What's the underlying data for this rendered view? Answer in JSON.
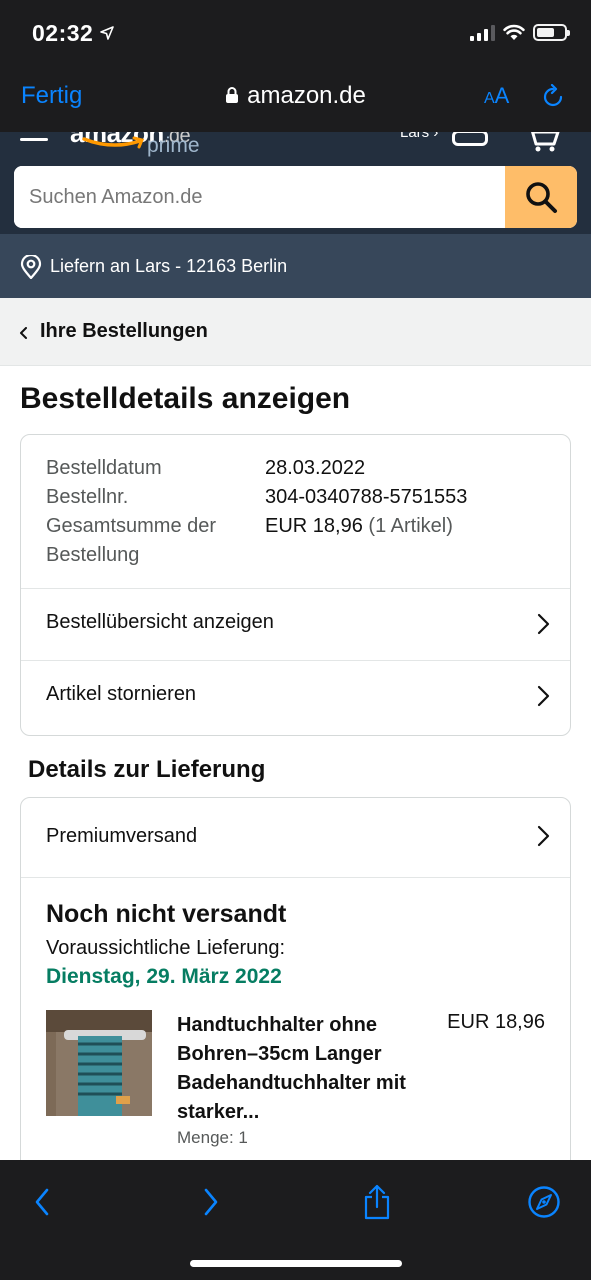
{
  "status_bar": {
    "time": "02:32"
  },
  "safari": {
    "done_label": "Fertig",
    "url": "amazon.de",
    "aa_label_small": "A",
    "aa_label_large": "A"
  },
  "amazon_header": {
    "logo_text": "amazon",
    "logo_tld": ".de",
    "prime_label": "prime",
    "account_label": "Lars ›",
    "search_placeholder": "Suchen Amazon.de",
    "deliver_to": "Liefern an Lars - 12163 Berlin"
  },
  "breadcrumb": {
    "label": "Ihre Bestellungen"
  },
  "page_title": "Bestelldetails anzeigen",
  "order": {
    "date_label": "Bestelldatum",
    "date_value": "28.03.2022",
    "number_label": "Bestellnr.",
    "number_value": "304-0340788-5751553",
    "total_label": "Gesamtsumme der Bestellung",
    "total_value": "EUR 18,96",
    "total_count": "(1 Artikel)",
    "links": [
      {
        "label": "Bestellübersicht anzeigen"
      },
      {
        "label": "Artikel stornieren"
      }
    ]
  },
  "delivery": {
    "section_title": "Details zur Lieferung",
    "shipping_method": "Premiumversand",
    "status": "Noch nicht versandt",
    "eta_label": "Voraussichtliche Lieferung:",
    "eta_date": "Dienstag, 29. März 2022",
    "item": {
      "title": "Handtuchhalter ohne Bohren–35cm Langer Badehandtuchhalter mit starker...",
      "price": "EUR 18,96",
      "quantity": "Menge: 1"
    }
  },
  "colors": {
    "accent": "#0a84ff",
    "amazon_header": "#232f3e",
    "deliver_bar": "#37475a",
    "search_button": "#febd69",
    "eta_green": "#067d62"
  },
  "icons": {
    "status_bar": [
      "location-arrow-icon",
      "signal-icon",
      "wifi-icon",
      "battery-icon"
    ],
    "safari_top": [
      "lock-icon",
      "reload-icon"
    ],
    "safari_bottom": [
      "back-icon",
      "forward-icon",
      "share-icon",
      "compass-icon"
    ]
  }
}
